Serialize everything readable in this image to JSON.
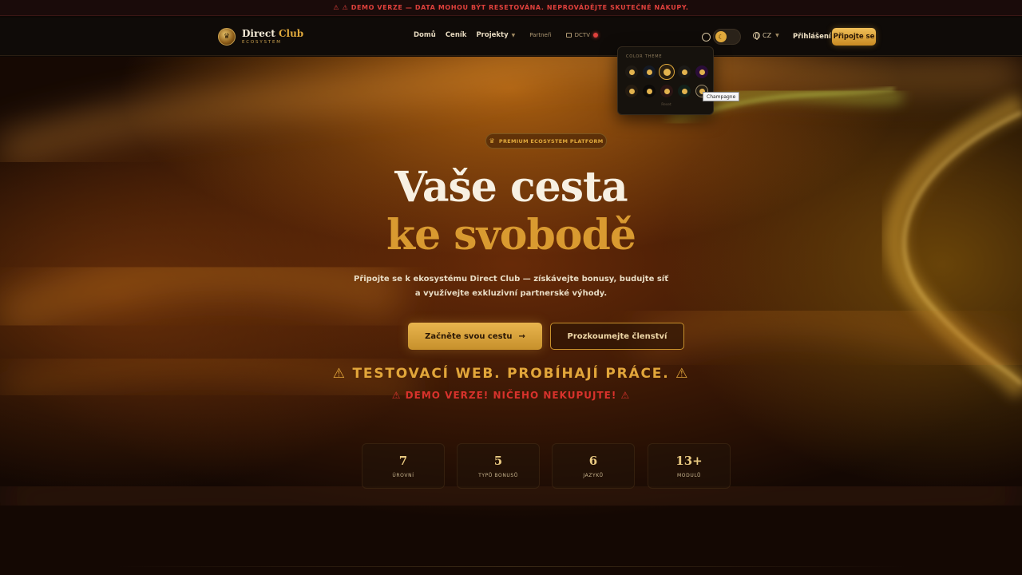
{
  "banner": {
    "text": "⚠ ⚠ DEMO VERZE — DATA MOHOU BÝT RESETOVÁNA. NEPROVÁDĚJTE SKUTEČNÉ NÁKUPY."
  },
  "header": {
    "logo_title_1": "Direct ",
    "logo_title_2": "Club",
    "logo_subtitle": "ECOSYSTEM",
    "nav": {
      "home": "Domů",
      "pricing": "Ceník",
      "projects": "Projekty",
      "partners": "Partneři",
      "dctv": "DCTV"
    },
    "lang": "CZ",
    "login": "Přihlášení",
    "join": "Připojte se"
  },
  "theme_popover": {
    "title": "COLOR THEME",
    "footer": "Reset",
    "tooltip": "Champagne",
    "swatches": [
      {
        "bg": "#1f1a14",
        "dot": "#e3b34e"
      },
      {
        "bg": "#151a24",
        "dot": "#e3b34e"
      },
      {
        "bg": "#2a1f10",
        "dot": "#e3b34e",
        "selected": true
      },
      {
        "bg": "#1c1a17",
        "dot": "#e3b34e"
      },
      {
        "bg": "#2a0d38",
        "dot": "#e3b34e"
      },
      {
        "bg": "#241b11",
        "dot": "#e3b34e"
      },
      {
        "bg": "#0c0a08",
        "dot": "#e3b34e"
      },
      {
        "bg": "#2a1514",
        "dot": "#e3b34e"
      },
      {
        "bg": "#12201a",
        "dot": "#e3b34e"
      },
      {
        "bg": "#221d14",
        "dot": "#e3b34e",
        "hover": true
      }
    ]
  },
  "hero": {
    "badge": "PREMIUM ECOSYSTEM PLATFORM",
    "title_line1": "Vaše cesta",
    "title_line2": "ke svobodě",
    "subtitle": "Připojte se k ekosystému Direct Club — získávejte bonusy, budujte síť a využívejte exkluzivní partnerské výhody.",
    "cta_primary": "Začněte svou cestu",
    "cta_primary_arrow": "→",
    "cta_secondary": "Prozkoumejte členství",
    "warning_1": "⚠ TESTOVACÍ WEB. PROBÍHAJÍ PRÁCE. ⚠",
    "warning_2": "⚠ DEMO VERZE! NIČEHO NEKUPUJTE! ⚠"
  },
  "stats": [
    {
      "value": "7",
      "label": "ÚROVNÍ"
    },
    {
      "value": "5",
      "label": "TYPŮ BONUSŮ"
    },
    {
      "value": "6",
      "label": "JAZYKŮ"
    },
    {
      "value": "13+",
      "label": "MODULŮ"
    }
  ],
  "colors": {
    "accent": "#e0a93c",
    "danger": "#d8322c",
    "background": "#0d0805"
  }
}
